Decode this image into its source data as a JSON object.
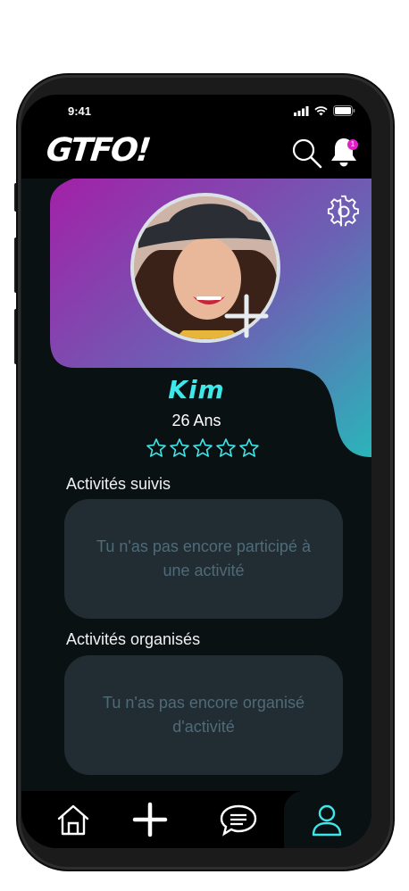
{
  "status_bar": {
    "time": "9:41"
  },
  "app": {
    "logo": "GTFO!",
    "notification_count": "1"
  },
  "profile": {
    "name": "Kim",
    "age": "26 Ans",
    "rating": 0,
    "rating_max": 5
  },
  "sections": {
    "followed": {
      "title": "Activités suivis",
      "empty_message": "Tu n'as pas encore participé à une activité"
    },
    "organized": {
      "title": "Activités organisés",
      "empty_message": "Tu n'as pas encore organisé d'activité"
    }
  },
  "tabbar": {
    "items": [
      {
        "icon": "home-icon"
      },
      {
        "icon": "plus-icon"
      },
      {
        "icon": "chat-icon"
      },
      {
        "icon": "profile-icon",
        "active": true
      }
    ]
  },
  "colors": {
    "accent": "#3ee7ea",
    "gradient_start": "#a320a8",
    "gradient_end": "#2ab5b9",
    "badge": "#e021c8",
    "background": "#0a1113",
    "card": "#222c33"
  }
}
